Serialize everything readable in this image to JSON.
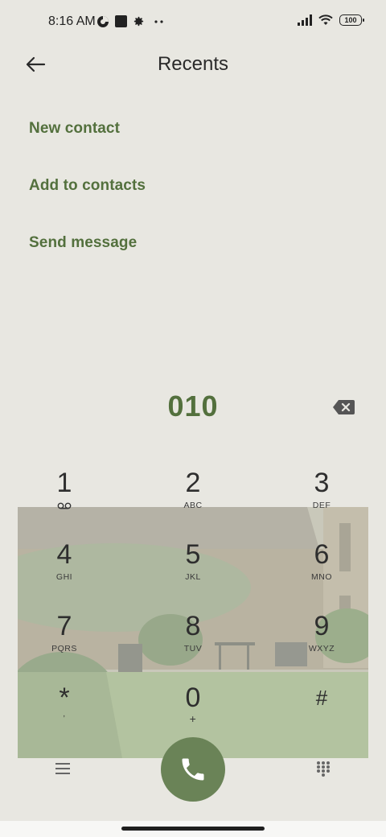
{
  "status_bar": {
    "time": "8:16 AM",
    "battery": "100",
    "icons": [
      "data-saver-icon",
      "square-notification-icon",
      "settings-gear-icon",
      "more-dots-icon",
      "signal-icon",
      "wifi-icon",
      "battery-icon"
    ]
  },
  "header": {
    "title": "Recents",
    "back_icon": "arrow-left-icon"
  },
  "actions": [
    {
      "label": "New contact"
    },
    {
      "label": "Add to contacts"
    },
    {
      "label": "Send message"
    }
  ],
  "dialer": {
    "number": "010",
    "backspace_icon": "backspace-icon"
  },
  "keypad": [
    {
      "digit": "1",
      "letters": ""
    },
    {
      "digit": "2",
      "letters": "ABC"
    },
    {
      "digit": "3",
      "letters": "DEF"
    },
    {
      "digit": "4",
      "letters": "GHI"
    },
    {
      "digit": "5",
      "letters": "JKL"
    },
    {
      "digit": "6",
      "letters": "MNO"
    },
    {
      "digit": "7",
      "letters": "PQRS"
    },
    {
      "digit": "8",
      "letters": "TUV"
    },
    {
      "digit": "9",
      "letters": "WXYZ"
    },
    {
      "digit": "*",
      "letters": ","
    },
    {
      "digit": "0",
      "letters": "+"
    },
    {
      "digit": "#",
      "letters": ""
    }
  ],
  "bottom_bar": {
    "menu_icon": "menu-lines-icon",
    "call_icon": "phone-icon",
    "keypad_icon": "dialpad-icon"
  },
  "colors": {
    "accent": "#53703d",
    "background": "#e8e7e1",
    "call_button": "#6a8357"
  }
}
